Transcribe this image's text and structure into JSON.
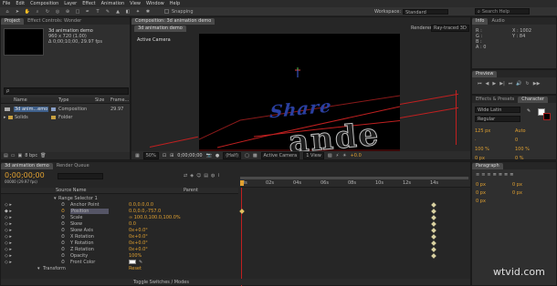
{
  "menu": [
    "File",
    "Edit",
    "Composition",
    "Layer",
    "Effect",
    "Animation",
    "View",
    "Window",
    "Help"
  ],
  "toolbar": {
    "snapping": "Snapping",
    "workspace_label": "Workspace:",
    "workspace_value": "Standard",
    "search_placeholder": "Search Help"
  },
  "project": {
    "tabs": [
      "Project",
      "Effect Controls: Wonder"
    ],
    "comp_name": "3d animation demo",
    "comp_size": "960 x 720 (1.00)",
    "comp_duration": "Δ 0;00;10;00, 29.97 fps",
    "search_placeholder": "ρ",
    "columns": [
      "Name",
      "Type",
      "Size",
      "Frame..."
    ],
    "items": [
      {
        "name": "3d anim...emo",
        "type": "Composition",
        "size": "",
        "frame": "29.97"
      },
      {
        "name": "Solids",
        "type": "Folder",
        "size": "",
        "frame": ""
      }
    ],
    "bpc": "8 bpc"
  },
  "viewer": {
    "tab": "Composition: 3d animation demo",
    "sub_tab": "3d animation demo",
    "renderer_label": "Renderer:",
    "renderer_value": "Ray-traced 3D",
    "active_camera": "Active Camera",
    "text_top": "Share",
    "text_bottom": "ande",
    "zoom": "50%",
    "timecode": "0;00;00;00",
    "resolution": "(Half)",
    "view": "Active Camera",
    "views": "1 View",
    "exposure": "+0.0"
  },
  "info": {
    "tabs": [
      "Info",
      "Audio"
    ],
    "R": "R :",
    "G": "G :",
    "B": "B :",
    "A": "A : 0",
    "X": "X : 1002",
    "Y": "Y : 84"
  },
  "preview": {
    "tab": "Preview"
  },
  "effects": {
    "tabs": [
      "Effects & Presets",
      "Character"
    ],
    "font": "Wide Latin",
    "style": "Regular",
    "size": "125 px",
    "leading": "Auto",
    "tracking": "0",
    "vscale": "100 %",
    "hscale": "100 %",
    "baseline": "0 px",
    "tsume": "0 %"
  },
  "paragraph": {
    "tab": "Paragraph",
    "vals": [
      "0 px",
      "0 px",
      "0 px",
      "0 px",
      "0 px"
    ]
  },
  "timeline": {
    "tabs": [
      "3d animation demo",
      "Render Queue"
    ],
    "timecode": "0;00;00;00",
    "frame_info": "00000 (29.97 fps)",
    "columns": [
      "Source Name",
      "Parent"
    ],
    "ruler": [
      "0s",
      "02s",
      "04s",
      "06s",
      "08s",
      "10s",
      "12s",
      "14s"
    ],
    "rows": [
      {
        "label": "Range Selector 1",
        "value": ""
      },
      {
        "label": "Anchor Point",
        "value": "0.0,0.0,0.0"
      },
      {
        "label": "Position",
        "value": "0.0,0.0,-757.0"
      },
      {
        "label": "Scale",
        "value": "∞ 100.0,100.0,100.0%"
      },
      {
        "label": "Skew",
        "value": "0.0"
      },
      {
        "label": "Skew Axis",
        "value": "0x+0.0°"
      },
      {
        "label": "X Rotation",
        "value": "0x+0.0°"
      },
      {
        "label": "Y Rotation",
        "value": "0x+0.0°"
      },
      {
        "label": "Z Rotation",
        "value": "0x+0.0°"
      },
      {
        "label": "Opacity",
        "value": "100%"
      },
      {
        "label": "Front Color",
        "value": ""
      },
      {
        "label": "Transform",
        "value": "Reset"
      }
    ],
    "toggle": "Toggle Switches / Modes"
  },
  "watermark": "wtvid.com"
}
